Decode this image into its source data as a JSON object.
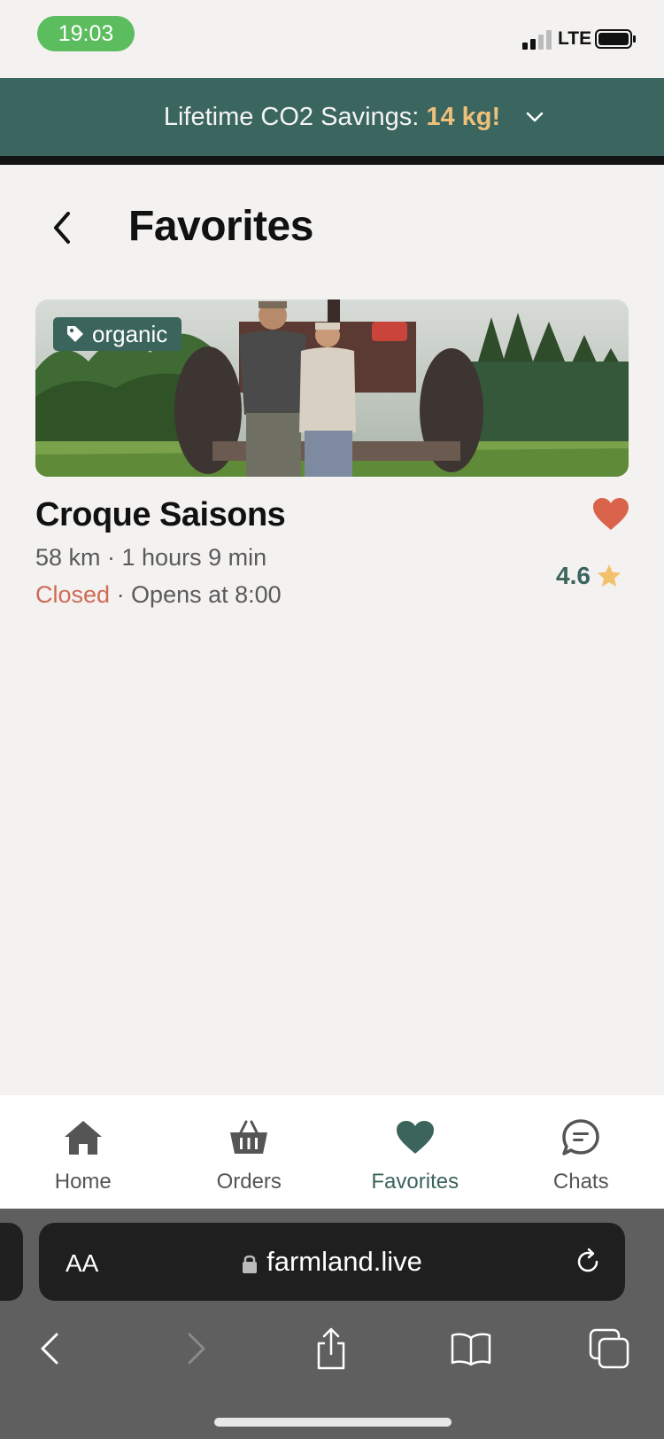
{
  "status_bar": {
    "time": "19:03",
    "network": "LTE"
  },
  "banner": {
    "label": "Lifetime CO2 Savings:",
    "value": "14 kg!"
  },
  "page": {
    "title": "Favorites"
  },
  "favorites": [
    {
      "tag": "organic",
      "name": "Croque Saisons",
      "meta": "58 km · 1 hours 9 min",
      "status": "Closed",
      "opening": "· Opens at 8:00",
      "rating": "4.6"
    }
  ],
  "nav": {
    "items": [
      {
        "label": "Home",
        "icon": "home-icon"
      },
      {
        "label": "Orders",
        "icon": "basket-icon"
      },
      {
        "label": "Favorites",
        "icon": "heart-icon"
      },
      {
        "label": "Chats",
        "icon": "chat-icon"
      }
    ],
    "active": "Favorites"
  },
  "browser": {
    "aa": "AA",
    "url": "farmland.live"
  },
  "colors": {
    "brand": "#3b665f",
    "accent": "#efc07a",
    "closed": "#d06a55",
    "heart": "#d9634b"
  }
}
